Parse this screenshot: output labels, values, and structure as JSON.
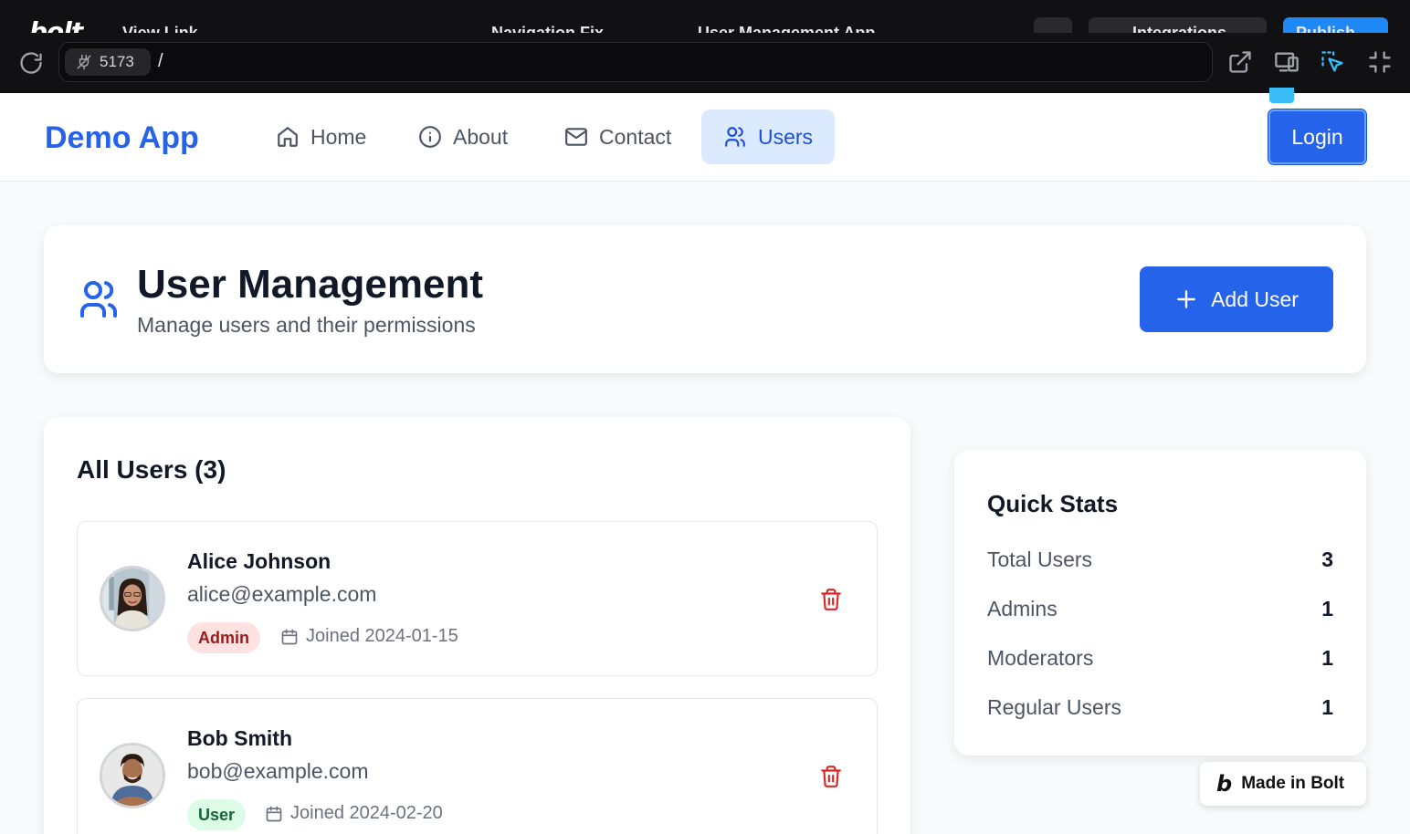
{
  "bolt": {
    "logo": "bolt",
    "project_fragments": [
      "View Link",
      "Navigation Fix",
      "User Management App"
    ],
    "integrations_label": "Integrations",
    "publish_label": "Publish"
  },
  "browser": {
    "port": "5173",
    "path": "/"
  },
  "navbar": {
    "brand": "Demo App",
    "items": [
      {
        "label": "Home",
        "icon": "home-icon"
      },
      {
        "label": "About",
        "icon": "info-icon"
      },
      {
        "label": "Contact",
        "icon": "mail-icon"
      },
      {
        "label": "Users",
        "icon": "users-icon",
        "active": true
      }
    ],
    "login_label": "Login"
  },
  "header": {
    "title": "User Management",
    "subtitle": "Manage users and their permissions",
    "add_label": "Add User"
  },
  "users": {
    "title": "All Users (3)",
    "list": [
      {
        "name": "Alice Johnson",
        "email": "alice@example.com",
        "role": "Admin",
        "joined": "Joined 2024-01-15",
        "role_bg": "#fee2e2",
        "role_color": "#991b1b"
      },
      {
        "name": "Bob Smith",
        "email": "bob@example.com",
        "role": "User",
        "joined": "Joined 2024-02-20",
        "role_bg": "#dcfce7",
        "role_color": "#166534"
      }
    ]
  },
  "stats": {
    "title": "Quick Stats",
    "rows": [
      {
        "label": "Total Users",
        "value": "3"
      },
      {
        "label": "Admins",
        "value": "1"
      },
      {
        "label": "Moderators",
        "value": "1"
      },
      {
        "label": "Regular Users",
        "value": "1"
      }
    ]
  },
  "made_in": "Made in Bolt",
  "colors": {
    "accent": "#2563eb",
    "danger": "#dc2626"
  }
}
